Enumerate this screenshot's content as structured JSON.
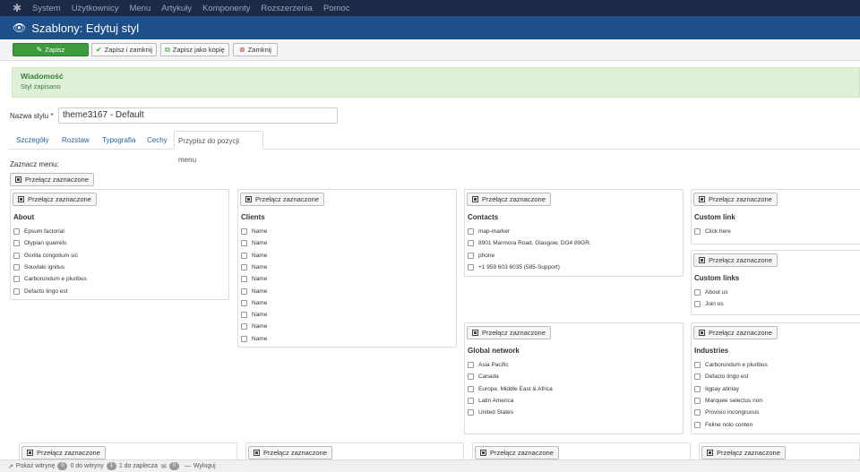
{
  "nav": {
    "items": [
      "System",
      "Użytkownicy",
      "Menu",
      "Artykuły",
      "Komponenty",
      "Rozszerzenia",
      "Pomoc"
    ]
  },
  "title": "Szablony: Edytuj styl",
  "toolbar": {
    "save": "Zapisz",
    "save_close": "Zapisz i zamknij",
    "save_copy": "Zapisz jako kopię",
    "close": "Zamknij"
  },
  "message": {
    "heading": "Wiadomość",
    "body": "Styl zapisano"
  },
  "style_name": {
    "label": "Nazwa stylu *",
    "value": "theme3167 - Default"
  },
  "tabs": [
    "Szczegóły",
    "Rozstaw",
    "Typografia",
    "Cechy",
    "Przypisz do pozycji menu"
  ],
  "menu_label": "Zaznacz menu:",
  "toggle_label": "Przełącz zaznaczone",
  "cards": [
    {
      "title": "About",
      "items": [
        "Epsum factorial",
        "Olypian quarrels",
        "Gorilla congolium sic",
        "Souvlaki ignitus",
        "Carborundum e pluribus",
        "Defacto lingo est"
      ]
    },
    {
      "title": "Clients",
      "items": [
        "Name",
        "Name",
        "Name",
        "Name",
        "Name",
        "Name",
        "Name",
        "Name",
        "Name",
        "Name"
      ]
    },
    {
      "title": "Contacts",
      "items": [
        "map-marker",
        "8901 Marmora Road, Glasgow, DO4 89GR.",
        "phone",
        "+1 959 603 6035 (585-Support)"
      ]
    },
    {
      "title": "Custom link",
      "items": [
        "Click here"
      ]
    },
    {
      "title": "Custom links",
      "items": [
        "About us",
        "Join us"
      ]
    },
    {
      "title": "Global network",
      "items": [
        "Asia Pacific",
        "Canada",
        "Europe, Middle East & Africa",
        "Latin America",
        "United States"
      ]
    },
    {
      "title": "Industries",
      "items": [
        "Carborundum e pluribus",
        "Defacto lingo est",
        "Iigpay atinlay",
        "Marquee selectus non",
        "Provisio incongruous",
        "Feline nolo conten"
      ]
    }
  ],
  "status": {
    "view_site": "Pokaż witrynę",
    "visitors_count": "0",
    "visitors_label": "0 do witryny",
    "admins_count": "1",
    "admins_label": "1 do zaplecza",
    "messages_count": "0",
    "logout": "Wyloguj"
  }
}
